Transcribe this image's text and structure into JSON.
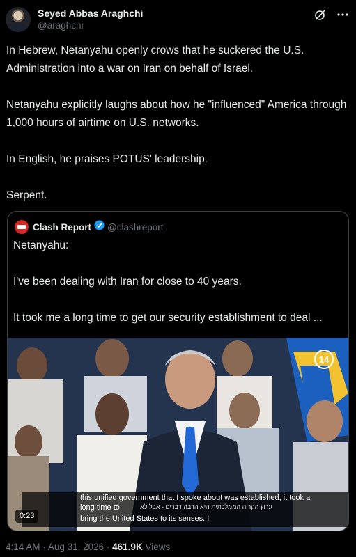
{
  "author": {
    "name": "Seyed Abbas Araghchi",
    "handle": "@araghchi"
  },
  "header_icons": [
    "grok-icon",
    "more-options-icon"
  ],
  "tweet": {
    "paragraphs": [
      "In Hebrew, Netanyahu openly crows that he suckered the U.S. Administration into a war on Iran on behalf of Israel.",
      "Netanyahu explicitly laughs about how he \"influenced\" America through 1,000 hours of airtime on U.S. networks.",
      "In English, he praises POTUS' leadership.",
      "Serpent."
    ]
  },
  "quote": {
    "name": "Clash Report",
    "handle": "@clashreport",
    "verified": true,
    "paragraphs": [
      "Netanyahu:",
      "I've been dealing with Iran for close to 40 years.",
      "It took me a long time to get our security establishment to deal ..."
    ],
    "video": {
      "timestamp": "0:23",
      "channel_logo": "14",
      "subtitle_lines": [
        "this unified government that I spoke about was established, it took a",
        "long time to",
        "bring the United States to its senses. I"
      ],
      "hebrew_overlay": "ערוץ הקריה הממלכתית היא הרבה דברים - אבל לא"
    }
  },
  "footer": {
    "time": "4:14 AM",
    "date": "Aug 31, 2026",
    "views_count": "461.9K",
    "views_label": "Views"
  }
}
